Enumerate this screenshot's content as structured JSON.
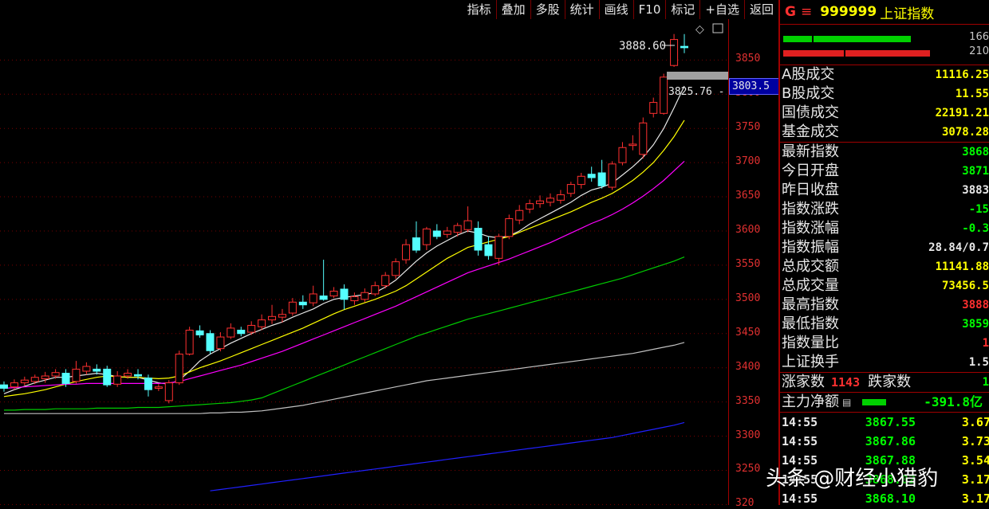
{
  "toolbar": {
    "items": [
      "指标",
      "叠加",
      "多股",
      "统计",
      "画线",
      "F10",
      "标记",
      "+自选",
      "返回"
    ]
  },
  "chart_data": {
    "type": "candlestick",
    "ylim": [
      3200,
      3890
    ],
    "ticks": [
      3850,
      3800,
      3750,
      3700,
      3650,
      3600,
      3550,
      3500,
      3450,
      3400,
      3350,
      3300,
      3250,
      3200
    ],
    "tick_labels": [
      "3850",
      "3800",
      "3750",
      "3700",
      "3650",
      "3600",
      "3550",
      "3500",
      "3450",
      "3400",
      "3350",
      "3300",
      "3250",
      "320"
    ],
    "high_label": "3888.60",
    "low_label": "3825.76 -",
    "cursor_value": "3803.5",
    "candles": [
      {
        "o": 3375,
        "c": 3370,
        "h": 3380,
        "l": 3365
      },
      {
        "o": 3372,
        "c": 3378,
        "h": 3383,
        "l": 3368
      },
      {
        "o": 3378,
        "c": 3382,
        "h": 3387,
        "l": 3374
      },
      {
        "o": 3380,
        "c": 3386,
        "h": 3390,
        "l": 3376
      },
      {
        "o": 3384,
        "c": 3388,
        "h": 3394,
        "l": 3378
      },
      {
        "o": 3388,
        "c": 3393,
        "h": 3398,
        "l": 3384
      },
      {
        "o": 3392,
        "c": 3377,
        "h": 3398,
        "l": 3372
      },
      {
        "o": 3380,
        "c": 3398,
        "h": 3410,
        "l": 3377
      },
      {
        "o": 3395,
        "c": 3402,
        "h": 3408,
        "l": 3390
      },
      {
        "o": 3398,
        "c": 3395,
        "h": 3405,
        "l": 3390
      },
      {
        "o": 3398,
        "c": 3375,
        "h": 3403,
        "l": 3372
      },
      {
        "o": 3376,
        "c": 3388,
        "h": 3395,
        "l": 3372
      },
      {
        "o": 3388,
        "c": 3392,
        "h": 3398,
        "l": 3384
      },
      {
        "o": 3390,
        "c": 3388,
        "h": 3398,
        "l": 3383
      },
      {
        "o": 3385,
        "c": 3368,
        "h": 3390,
        "l": 3358
      },
      {
        "o": 3370,
        "c": 3372,
        "h": 3376,
        "l": 3366
      },
      {
        "o": 3352,
        "c": 3378,
        "h": 3382,
        "l": 3348
      },
      {
        "o": 3378,
        "c": 3420,
        "h": 3425,
        "l": 3375
      },
      {
        "o": 3420,
        "c": 3455,
        "h": 3460,
        "l": 3418
      },
      {
        "o": 3454,
        "c": 3448,
        "h": 3462,
        "l": 3444
      },
      {
        "o": 3450,
        "c": 3425,
        "h": 3455,
        "l": 3420
      },
      {
        "o": 3428,
        "c": 3445,
        "h": 3452,
        "l": 3424
      },
      {
        "o": 3445,
        "c": 3458,
        "h": 3465,
        "l": 3442
      },
      {
        "o": 3455,
        "c": 3450,
        "h": 3460,
        "l": 3446
      },
      {
        "o": 3452,
        "c": 3462,
        "h": 3468,
        "l": 3448
      },
      {
        "o": 3460,
        "c": 3470,
        "h": 3478,
        "l": 3455
      },
      {
        "o": 3470,
        "c": 3475,
        "h": 3492,
        "l": 3464
      },
      {
        "o": 3474,
        "c": 3478,
        "h": 3486,
        "l": 3466
      },
      {
        "o": 3480,
        "c": 3496,
        "h": 3502,
        "l": 3476
      },
      {
        "o": 3496,
        "c": 3492,
        "h": 3506,
        "l": 3486
      },
      {
        "o": 3495,
        "c": 3508,
        "h": 3520,
        "l": 3490
      },
      {
        "o": 3505,
        "c": 3500,
        "h": 3558,
        "l": 3498
      },
      {
        "o": 3505,
        "c": 3512,
        "h": 3518,
        "l": 3502
      },
      {
        "o": 3515,
        "c": 3500,
        "h": 3522,
        "l": 3485
      },
      {
        "o": 3498,
        "c": 3504,
        "h": 3510,
        "l": 3492
      },
      {
        "o": 3500,
        "c": 3510,
        "h": 3516,
        "l": 3496
      },
      {
        "o": 3508,
        "c": 3520,
        "h": 3526,
        "l": 3505
      },
      {
        "o": 3520,
        "c": 3535,
        "h": 3540,
        "l": 3516
      },
      {
        "o": 3535,
        "c": 3555,
        "h": 3560,
        "l": 3530
      },
      {
        "o": 3558,
        "c": 3580,
        "h": 3588,
        "l": 3552
      },
      {
        "o": 3590,
        "c": 3572,
        "h": 3614,
        "l": 3568
      },
      {
        "o": 3580,
        "c": 3603,
        "h": 3606,
        "l": 3572
      },
      {
        "o": 3600,
        "c": 3592,
        "h": 3610,
        "l": 3588
      },
      {
        "o": 3595,
        "c": 3600,
        "h": 3606,
        "l": 3590
      },
      {
        "o": 3598,
        "c": 3608,
        "h": 3612,
        "l": 3592
      },
      {
        "o": 3602,
        "c": 3615,
        "h": 3636,
        "l": 3598
      },
      {
        "o": 3604,
        "c": 3572,
        "h": 3614,
        "l": 3564
      },
      {
        "o": 3580,
        "c": 3564,
        "h": 3592,
        "l": 3558
      },
      {
        "o": 3560,
        "c": 3592,
        "h": 3596,
        "l": 3550
      },
      {
        "o": 3592,
        "c": 3618,
        "h": 3624,
        "l": 3588
      },
      {
        "o": 3616,
        "c": 3630,
        "h": 3638,
        "l": 3610
      },
      {
        "o": 3632,
        "c": 3640,
        "h": 3646,
        "l": 3626
      },
      {
        "o": 3640,
        "c": 3644,
        "h": 3652,
        "l": 3634
      },
      {
        "o": 3642,
        "c": 3648,
        "h": 3655,
        "l": 3636
      },
      {
        "o": 3645,
        "c": 3653,
        "h": 3660,
        "l": 3640
      },
      {
        "o": 3655,
        "c": 3668,
        "h": 3672,
        "l": 3650
      },
      {
        "o": 3668,
        "c": 3680,
        "h": 3685,
        "l": 3662
      },
      {
        "o": 3683,
        "c": 3678,
        "h": 3694,
        "l": 3672
      },
      {
        "o": 3685,
        "c": 3666,
        "h": 3704,
        "l": 3662
      },
      {
        "o": 3664,
        "c": 3698,
        "h": 3702,
        "l": 3660
      },
      {
        "o": 3700,
        "c": 3722,
        "h": 3730,
        "l": 3696
      },
      {
        "o": 3725,
        "c": 3727,
        "h": 3740,
        "l": 3718
      },
      {
        "o": 3712,
        "c": 3758,
        "h": 3766,
        "l": 3706
      },
      {
        "o": 3772,
        "c": 3788,
        "h": 3795,
        "l": 3766
      },
      {
        "o": 3772,
        "c": 3825,
        "h": 3830,
        "l": 3770
      },
      {
        "o": 3842,
        "c": 3880,
        "h": 3888,
        "l": 3840
      },
      {
        "o": 3870,
        "c": 3868,
        "h": 3888,
        "l": 3860
      }
    ],
    "ma_lines": [
      {
        "color": "#e8e8e8",
        "values": [
          3362,
          3368,
          3373,
          3378,
          3382,
          3386,
          3386,
          3388,
          3390,
          3392,
          3390,
          3387,
          3386,
          3386,
          3382,
          3378,
          3376,
          3382,
          3395,
          3410,
          3420,
          3428,
          3436,
          3443,
          3450,
          3456,
          3462,
          3467,
          3474,
          3480,
          3486,
          3494,
          3500,
          3503,
          3505,
          3507,
          3510,
          3518,
          3528,
          3542,
          3556,
          3568,
          3578,
          3586,
          3594,
          3600,
          3597,
          3592,
          3590,
          3593,
          3600,
          3610,
          3618,
          3626,
          3634,
          3642,
          3652,
          3660,
          3664,
          3670,
          3682,
          3694,
          3708,
          3726,
          3750,
          3780,
          3812
        ]
      },
      {
        "color": "#ffff00",
        "values": [
          3358,
          3360,
          3362,
          3365,
          3368,
          3372,
          3376,
          3380,
          3383,
          3386,
          3388,
          3387,
          3386,
          3386,
          3385,
          3384,
          3385,
          3388,
          3394,
          3400,
          3405,
          3410,
          3416,
          3422,
          3428,
          3434,
          3440,
          3446,
          3452,
          3458,
          3465,
          3472,
          3479,
          3485,
          3490,
          3495,
          3500,
          3506,
          3512,
          3520,
          3530,
          3540,
          3550,
          3560,
          3568,
          3576,
          3580,
          3584,
          3588,
          3592,
          3598,
          3604,
          3610,
          3616,
          3622,
          3628,
          3635,
          3642,
          3648,
          3655,
          3664,
          3674,
          3686,
          3700,
          3718,
          3738,
          3762
        ]
      },
      {
        "color": "#ff00ff",
        "values": [
          3370,
          3371,
          3372,
          3373,
          3374,
          3375,
          3376,
          3376,
          3377,
          3377,
          3377,
          3377,
          3377,
          3377,
          3377,
          3377,
          3378,
          3380,
          3384,
          3388,
          3392,
          3396,
          3400,
          3404,
          3409,
          3414,
          3419,
          3424,
          3430,
          3436,
          3442,
          3448,
          3454,
          3460,
          3466,
          3472,
          3478,
          3484,
          3490,
          3497,
          3504,
          3511,
          3518,
          3525,
          3532,
          3539,
          3544,
          3549,
          3554,
          3559,
          3565,
          3571,
          3577,
          3583,
          3590,
          3597,
          3604,
          3611,
          3617,
          3624,
          3632,
          3641,
          3651,
          3662,
          3674,
          3688,
          3702
        ]
      },
      {
        "color": "#00cc00",
        "values": [
          3338,
          3338,
          3339,
          3339,
          3339,
          3340,
          3340,
          3340,
          3340,
          3341,
          3341,
          3341,
          3341,
          3342,
          3342,
          3342,
          3343,
          3344,
          3345,
          3346,
          3347,
          3348,
          3349,
          3351,
          3353,
          3356,
          3362,
          3368,
          3374,
          3380,
          3386,
          3392,
          3398,
          3404,
          3410,
          3416,
          3422,
          3428,
          3434,
          3440,
          3446,
          3451,
          3456,
          3461,
          3466,
          3471,
          3475,
          3479,
          3483,
          3487,
          3491,
          3495,
          3499,
          3503,
          3507,
          3511,
          3515,
          3519,
          3523,
          3527,
          3531,
          3536,
          3541,
          3546,
          3551,
          3556,
          3562
        ]
      },
      {
        "color": "#c0c0c0",
        "values": [
          3333,
          3333,
          3333,
          3333,
          3333,
          3333,
          3333,
          3333,
          3333,
          3333,
          3333,
          3333,
          3333,
          3333,
          3333,
          3333,
          3333,
          3333,
          3333,
          3333,
          3334,
          3334,
          3335,
          3335,
          3336,
          3337,
          3339,
          3341,
          3343,
          3345,
          3348,
          3351,
          3354,
          3357,
          3360,
          3363,
          3366,
          3369,
          3372,
          3375,
          3378,
          3381,
          3383,
          3385,
          3387,
          3389,
          3391,
          3393,
          3395,
          3397,
          3399,
          3401,
          3403,
          3405,
          3407,
          3409,
          3411,
          3413,
          3415,
          3417,
          3419,
          3421,
          3424,
          3427,
          3430,
          3433,
          3437
        ]
      },
      {
        "color": "#2020ff",
        "start": 20,
        "values": [
          3220,
          3222,
          3224,
          3226,
          3228,
          3230,
          3232,
          3234,
          3236,
          3238,
          3240,
          3242,
          3244,
          3246,
          3248,
          3250,
          3252,
          3254,
          3256,
          3258,
          3260,
          3262,
          3264,
          3266,
          3268,
          3270,
          3272,
          3274,
          3276,
          3278,
          3280,
          3282,
          3284,
          3286,
          3288,
          3290,
          3292,
          3294,
          3296,
          3298,
          3301,
          3304,
          3307,
          3310,
          3313,
          3316,
          3320
        ]
      }
    ]
  },
  "header": {
    "g_label": "G",
    "menu_glyph": "≡",
    "code": "999999",
    "name": "上证指数",
    "bar_value_1": "166",
    "bar_value_2": "210"
  },
  "stats": [
    {
      "label": "A股成交",
      "value": "11116.25",
      "color": "yellow"
    },
    {
      "label": "B股成交",
      "value": "11.55",
      "color": "yellow"
    },
    {
      "label": "国债成交",
      "value": "22191.21",
      "color": "yellow"
    },
    {
      "label": "基金成交",
      "value": "3078.28",
      "color": "yellow"
    }
  ],
  "indices": [
    {
      "label": "最新指数",
      "value": "3868",
      "color": "green"
    },
    {
      "label": "今日开盘",
      "value": "3871",
      "color": "green"
    },
    {
      "label": "昨日收盘",
      "value": "3883",
      "color": "white"
    },
    {
      "label": "指数涨跌",
      "value": "-15",
      "color": "green"
    },
    {
      "label": "指数涨幅",
      "value": "-0.3",
      "color": "green"
    },
    {
      "label": "指数振幅",
      "value": "28.84/0.7",
      "color": "white"
    },
    {
      "label": "总成交额",
      "value": "11141.88",
      "color": "yellow"
    },
    {
      "label": "总成交量",
      "value": "73456.5",
      "color": "yellow"
    },
    {
      "label": "最高指数",
      "value": "3888",
      "color": "red"
    },
    {
      "label": "最低指数",
      "value": "3859",
      "color": "green"
    },
    {
      "label": "指数量比",
      "value": "1",
      "color": "red"
    },
    {
      "label": "上证换手",
      "value": "1.5",
      "color": "white"
    }
  ],
  "updown": {
    "up_label": "涨家数",
    "up_value": "1143",
    "down_label": "跌家数",
    "down_value": "1"
  },
  "fund": {
    "label": "主力净额",
    "value": "-391.8亿"
  },
  "ticks_table": [
    {
      "time": "14:55",
      "price": "3867.55",
      "vol": "3.67"
    },
    {
      "time": "14:55",
      "price": "3867.86",
      "vol": "3.73"
    },
    {
      "time": "14:55",
      "price": "3867.88",
      "vol": "3.54"
    },
    {
      "time": "14:55",
      "price": "3868.02",
      "vol": "3.17"
    },
    {
      "time": "14:55",
      "price": "3868.10",
      "vol": "3.17"
    }
  ],
  "watermark": "头条 @财经小猎豹"
}
